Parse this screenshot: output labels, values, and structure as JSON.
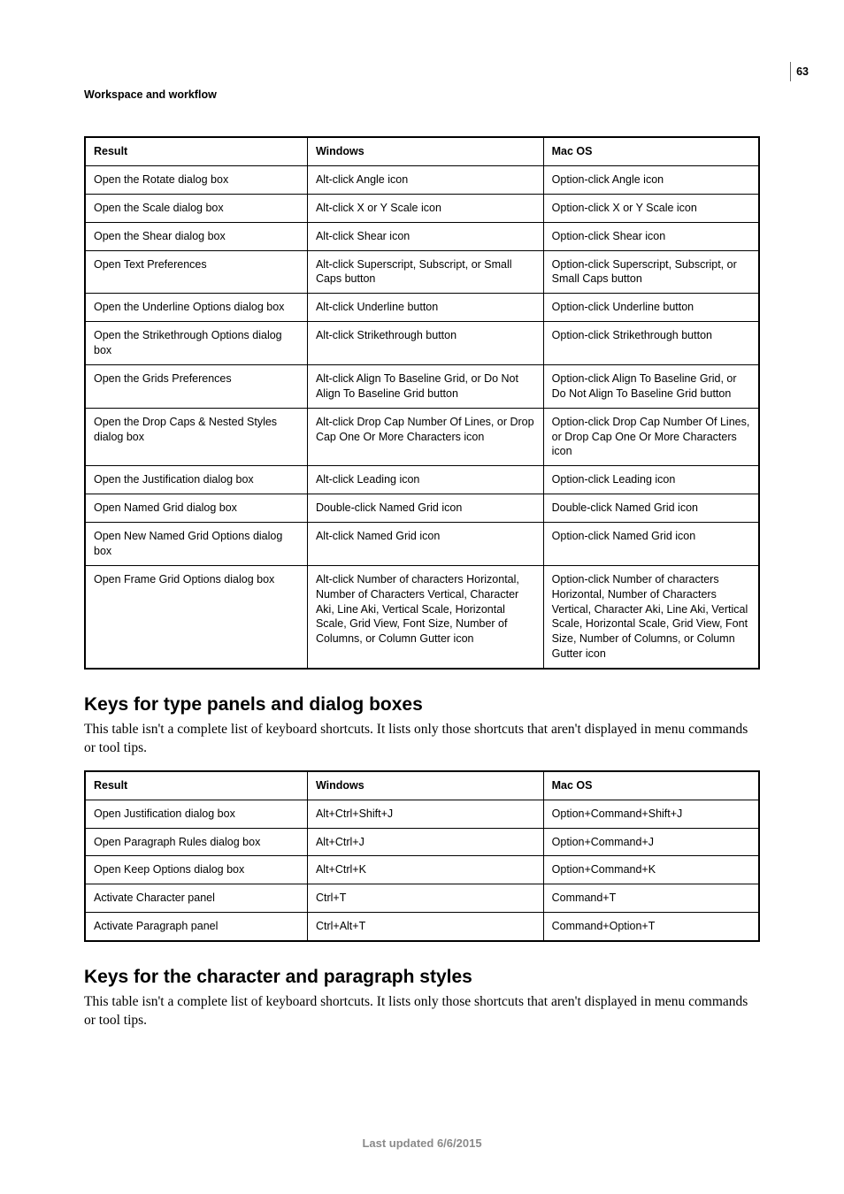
{
  "page_number": "63",
  "section_title": "Workspace and workflow",
  "table1": {
    "headers": {
      "result": "Result",
      "windows": "Windows",
      "macos": "Mac OS"
    },
    "rows": [
      {
        "result": "Open the Rotate dialog box",
        "win": "Alt-click Angle icon",
        "mac": "Option-click Angle icon"
      },
      {
        "result": "Open the Scale dialog box",
        "win": "Alt-click X or Y Scale icon",
        "mac": "Option-click X or Y Scale icon"
      },
      {
        "result": "Open the Shear dialog box",
        "win": "Alt-click Shear icon",
        "mac": "Option-click Shear icon"
      },
      {
        "result": "Open Text Preferences",
        "win": "Alt-click Superscript, Subscript, or Small Caps button",
        "mac": "Option-click Superscript, Subscript, or Small Caps button"
      },
      {
        "result": "Open the Underline Options dialog box",
        "win": "Alt-click Underline button",
        "mac": "Option-click Underline button"
      },
      {
        "result": "Open the Strikethrough Options dialog box",
        "win": "Alt-click Strikethrough button",
        "mac": "Option-click Strikethrough button"
      },
      {
        "result": "Open the Grids Preferences",
        "win": "Alt-click Align To Baseline Grid, or Do Not Align To Baseline Grid button",
        "mac": "Option-click Align To Baseline Grid, or Do Not Align To Baseline Grid button"
      },
      {
        "result": "Open the Drop Caps & Nested Styles dialog box",
        "win": "Alt-click Drop Cap Number Of Lines, or Drop Cap One Or More Characters icon",
        "mac": "Option-click Drop Cap Number Of Lines, or Drop Cap One Or More Characters icon"
      },
      {
        "result": "Open the Justification dialog box",
        "win": "Alt-click Leading icon",
        "mac": "Option-click Leading icon"
      },
      {
        "result": "Open Named Grid dialog box",
        "win": "Double-click Named Grid icon",
        "mac": "Double-click Named Grid icon"
      },
      {
        "result": "Open New Named Grid Options dialog box",
        "win": "Alt-click Named Grid icon",
        "mac": "Option-click Named Grid icon"
      },
      {
        "result": "Open Frame Grid Options dialog box",
        "win": "Alt-click Number of characters Horizontal, Number of Characters Vertical, Character Aki, Line Aki, Vertical Scale, Horizontal Scale, Grid View, Font Size, Number of Columns, or Column Gutter icon",
        "mac": "Option-click Number of characters Horizontal, Number of Characters Vertical, Character Aki, Line Aki, Vertical Scale, Horizontal Scale, Grid View, Font Size, Number of Columns, or Column Gutter icon"
      }
    ]
  },
  "section2": {
    "heading": "Keys for type panels and dialog boxes",
    "intro": "This table isn't a complete list of keyboard shortcuts. It lists only those shortcuts that aren't displayed in menu commands or tool tips.",
    "headers": {
      "result": "Result",
      "windows": "Windows",
      "macos": "Mac OS"
    },
    "rows": [
      {
        "result": "Open Justification dialog box",
        "win": "Alt+Ctrl+Shift+J",
        "mac": "Option+Command+Shift+J"
      },
      {
        "result": "Open Paragraph Rules dialog box",
        "win": "Alt+Ctrl+J",
        "mac": "Option+Command+J"
      },
      {
        "result": "Open Keep Options dialog box",
        "win": "Alt+Ctrl+K",
        "mac": "Option+Command+K"
      },
      {
        "result": "Activate Character panel",
        "win": "Ctrl+T",
        "mac": "Command+T"
      },
      {
        "result": "Activate Paragraph panel",
        "win": "Ctrl+Alt+T",
        "mac": "Command+Option+T"
      }
    ]
  },
  "section3": {
    "heading": "Keys for the character and paragraph styles",
    "intro": "This table isn't a complete list of keyboard shortcuts. It lists only those shortcuts that aren't displayed in menu commands or tool tips."
  },
  "footer": "Last updated 6/6/2015"
}
